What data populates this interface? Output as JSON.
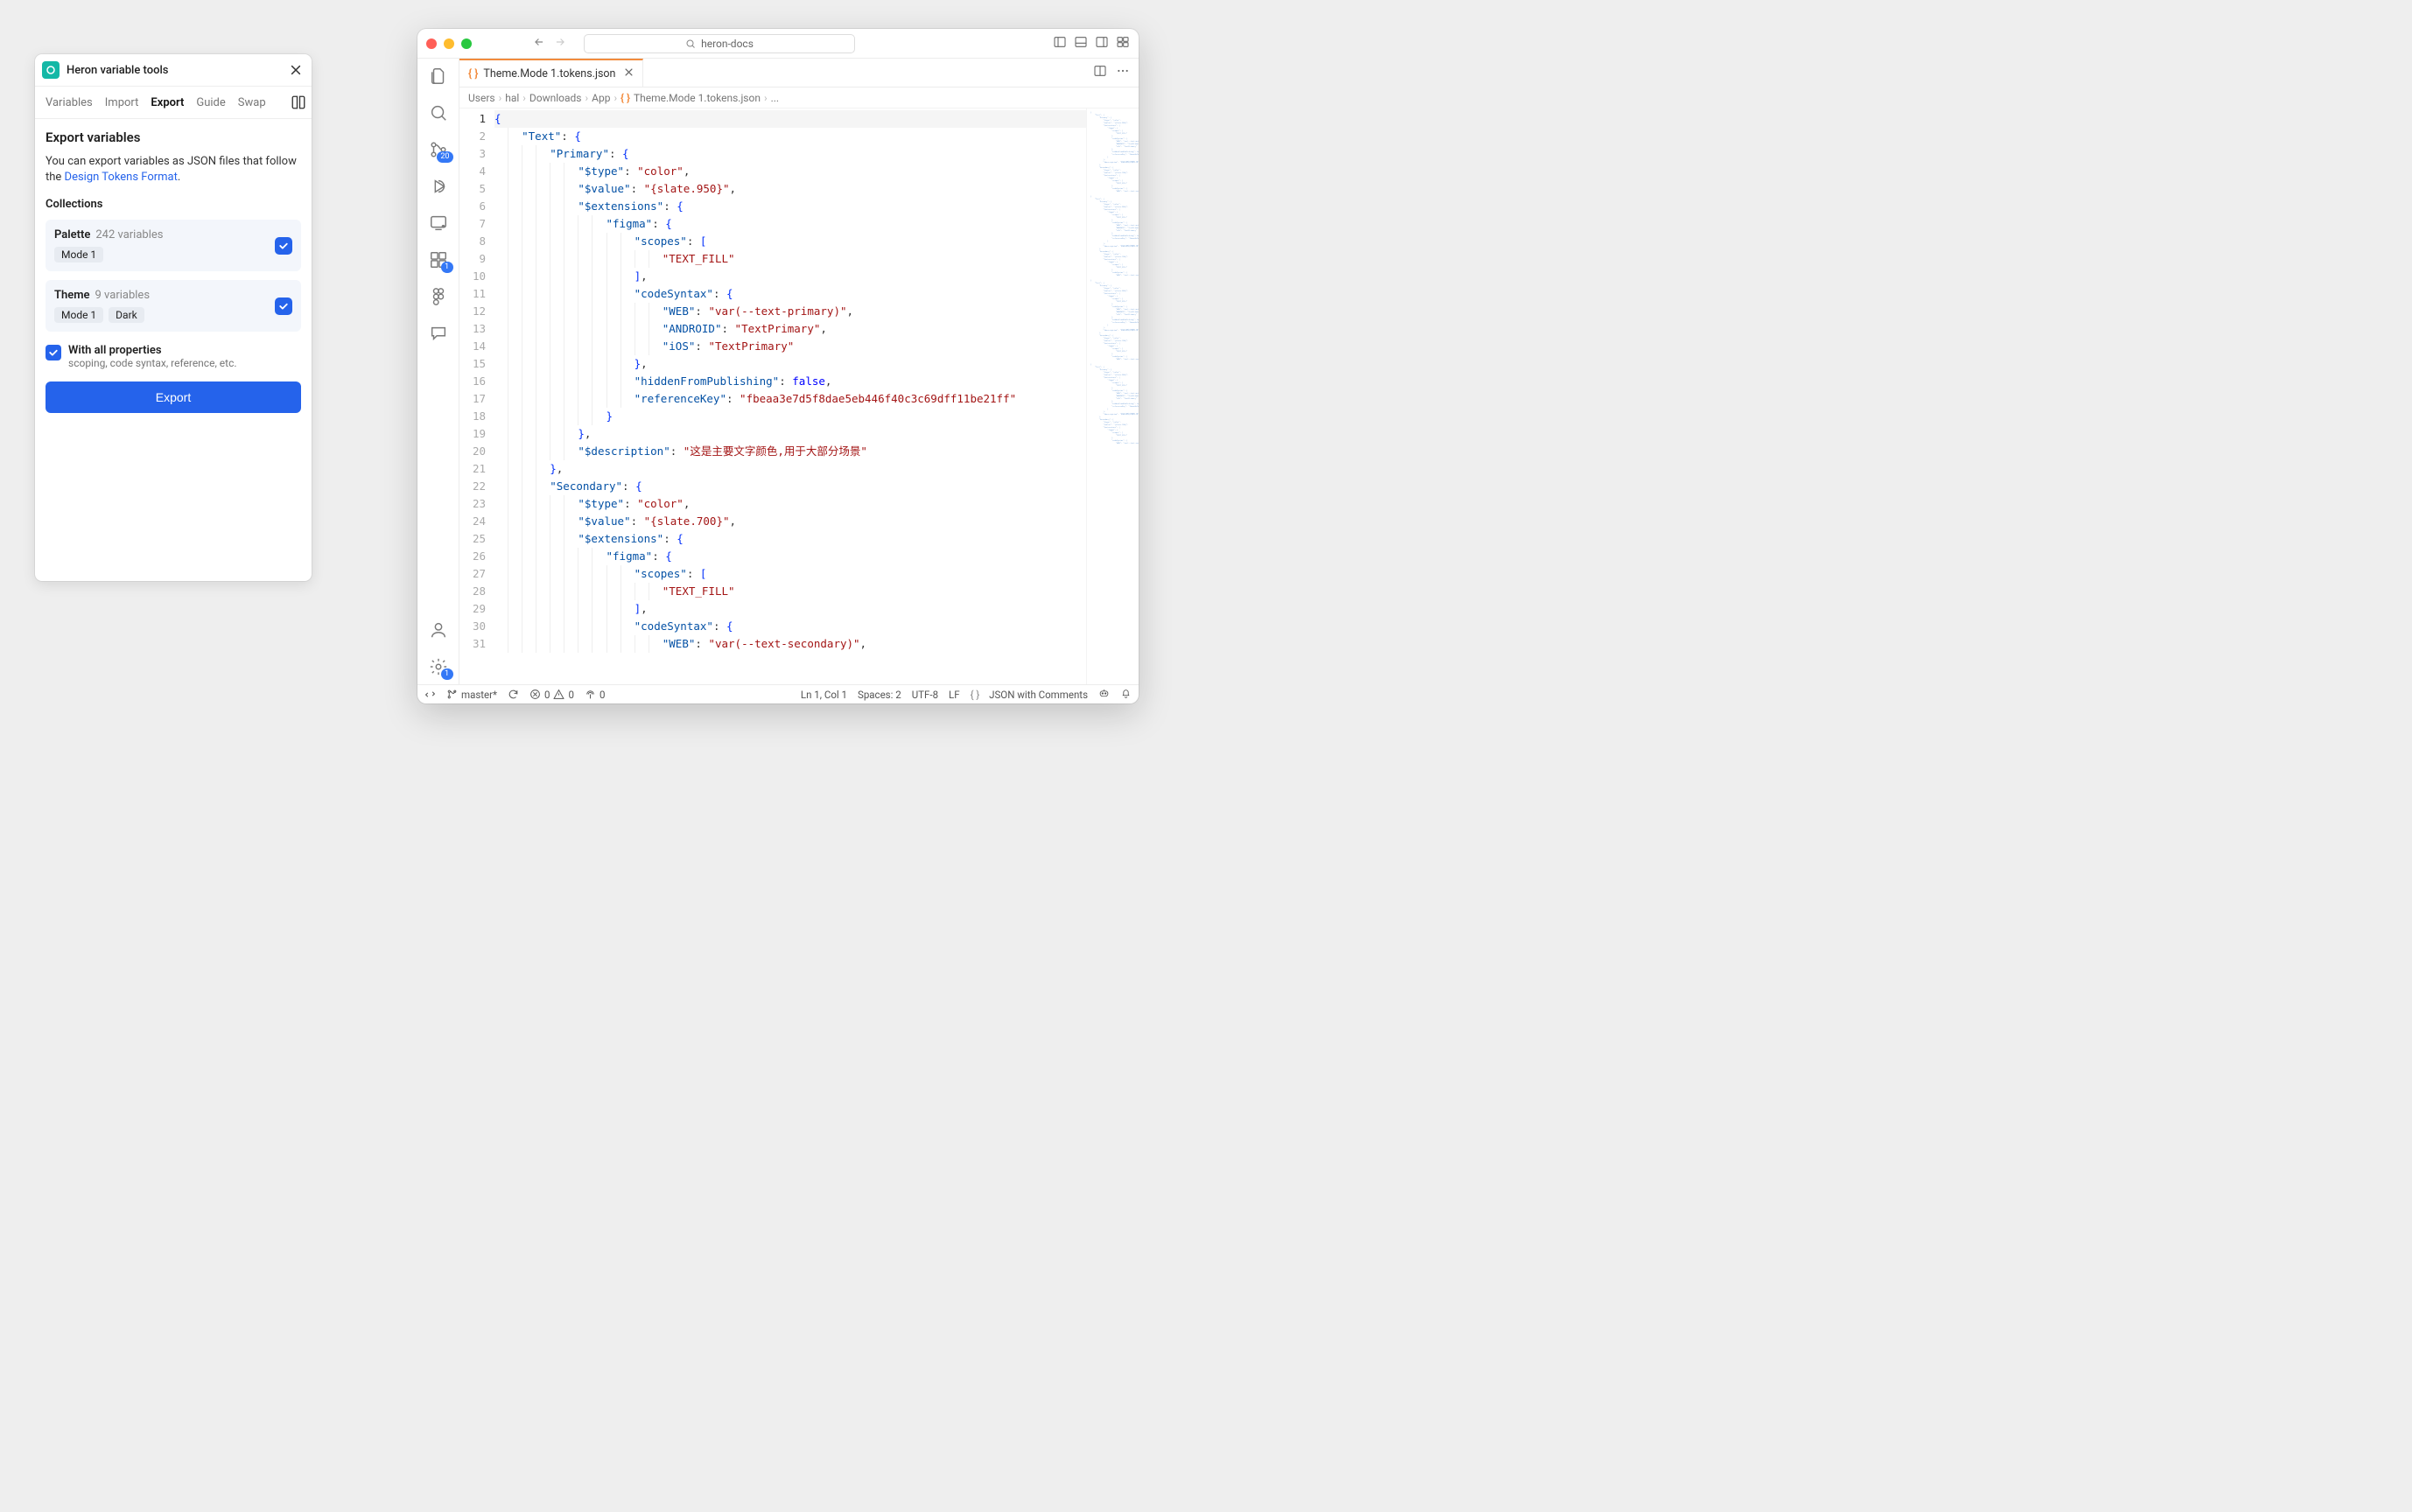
{
  "panel": {
    "title": "Heron variable tools",
    "tabs": {
      "variables": "Variables",
      "import": "Import",
      "export": "Export",
      "guide": "Guide",
      "swap": "Swap"
    },
    "heading": "Export variables",
    "desc_prefix": "You can export variables as JSON files that follow the ",
    "desc_link": "Design Tokens Format",
    "desc_suffix": ".",
    "collections_label": "Collections",
    "collections": [
      {
        "name": "Palette",
        "count": "242 variables",
        "modes": [
          "Mode 1"
        ]
      },
      {
        "name": "Theme",
        "count": "9 variables",
        "modes": [
          "Mode 1",
          "Dark"
        ]
      }
    ],
    "option": {
      "label": "With all properties",
      "sub": "scoping, code syntax, reference, etc."
    },
    "export_button": "Export"
  },
  "vscode": {
    "search_text": "heron-docs",
    "tab": {
      "name": "Theme.Mode 1.tokens.json"
    },
    "breadcrumb": [
      "Users",
      "hal",
      "Downloads",
      "App",
      "Theme.Mode 1.tokens.json",
      "..."
    ],
    "activity_badges": {
      "scm": "20",
      "ext": "1",
      "gear": "1"
    },
    "code_lines": [
      [
        {
          "t": "brace",
          "v": "{"
        }
      ],
      [
        {
          "pad": 2
        },
        {
          "t": "key",
          "v": "\"Text\""
        },
        {
          "t": "punc",
          "v": ": "
        },
        {
          "t": "brace",
          "v": "{"
        }
      ],
      [
        {
          "pad": 4
        },
        {
          "t": "key",
          "v": "\"Primary\""
        },
        {
          "t": "punc",
          "v": ": "
        },
        {
          "t": "brace",
          "v": "{"
        }
      ],
      [
        {
          "pad": 6
        },
        {
          "t": "key",
          "v": "\"$type\""
        },
        {
          "t": "punc",
          "v": ": "
        },
        {
          "t": "str",
          "v": "\"color\""
        },
        {
          "t": "punc",
          "v": ","
        }
      ],
      [
        {
          "pad": 6
        },
        {
          "t": "key",
          "v": "\"$value\""
        },
        {
          "t": "punc",
          "v": ": "
        },
        {
          "t": "str",
          "v": "\"{slate.950}\""
        },
        {
          "t": "punc",
          "v": ","
        }
      ],
      [
        {
          "pad": 6
        },
        {
          "t": "key",
          "v": "\"$extensions\""
        },
        {
          "t": "punc",
          "v": ": "
        },
        {
          "t": "brace",
          "v": "{"
        }
      ],
      [
        {
          "pad": 8
        },
        {
          "t": "key",
          "v": "\"figma\""
        },
        {
          "t": "punc",
          "v": ": "
        },
        {
          "t": "brace",
          "v": "{"
        }
      ],
      [
        {
          "pad": 10
        },
        {
          "t": "key",
          "v": "\"scopes\""
        },
        {
          "t": "punc",
          "v": ": "
        },
        {
          "t": "brace",
          "v": "["
        }
      ],
      [
        {
          "pad": 12
        },
        {
          "t": "str",
          "v": "\"TEXT_FILL\""
        }
      ],
      [
        {
          "pad": 10
        },
        {
          "t": "brace",
          "v": "]"
        },
        {
          "t": "punc",
          "v": ","
        }
      ],
      [
        {
          "pad": 10
        },
        {
          "t": "key",
          "v": "\"codeSyntax\""
        },
        {
          "t": "punc",
          "v": ": "
        },
        {
          "t": "brace",
          "v": "{"
        }
      ],
      [
        {
          "pad": 12
        },
        {
          "t": "key",
          "v": "\"WEB\""
        },
        {
          "t": "punc",
          "v": ": "
        },
        {
          "t": "str",
          "v": "\"var(--text-primary)\""
        },
        {
          "t": "punc",
          "v": ","
        }
      ],
      [
        {
          "pad": 12
        },
        {
          "t": "key",
          "v": "\"ANDROID\""
        },
        {
          "t": "punc",
          "v": ": "
        },
        {
          "t": "str",
          "v": "\"TextPrimary\""
        },
        {
          "t": "punc",
          "v": ","
        }
      ],
      [
        {
          "pad": 12
        },
        {
          "t": "key",
          "v": "\"iOS\""
        },
        {
          "t": "punc",
          "v": ": "
        },
        {
          "t": "str",
          "v": "\"TextPrimary\""
        }
      ],
      [
        {
          "pad": 10
        },
        {
          "t": "brace",
          "v": "}"
        },
        {
          "t": "punc",
          "v": ","
        }
      ],
      [
        {
          "pad": 10
        },
        {
          "t": "key",
          "v": "\"hiddenFromPublishing\""
        },
        {
          "t": "punc",
          "v": ": "
        },
        {
          "t": "bool",
          "v": "false"
        },
        {
          "t": "punc",
          "v": ","
        }
      ],
      [
        {
          "pad": 10
        },
        {
          "t": "key",
          "v": "\"referenceKey\""
        },
        {
          "t": "punc",
          "v": ": "
        },
        {
          "t": "str",
          "v": "\"fbeaa3e7d5f8dae5eb446f40c3c69dff11be21ff\""
        }
      ],
      [
        {
          "pad": 8
        },
        {
          "t": "brace",
          "v": "}"
        }
      ],
      [
        {
          "pad": 6
        },
        {
          "t": "brace",
          "v": "}"
        },
        {
          "t": "punc",
          "v": ","
        }
      ],
      [
        {
          "pad": 6
        },
        {
          "t": "key",
          "v": "\"$description\""
        },
        {
          "t": "punc",
          "v": ": "
        },
        {
          "t": "str",
          "v": "\"这是主要文字颜色,用于大部分场景\""
        }
      ],
      [
        {
          "pad": 4
        },
        {
          "t": "brace",
          "v": "}"
        },
        {
          "t": "punc",
          "v": ","
        }
      ],
      [
        {
          "pad": 4
        },
        {
          "t": "key",
          "v": "\"Secondary\""
        },
        {
          "t": "punc",
          "v": ": "
        },
        {
          "t": "brace",
          "v": "{"
        }
      ],
      [
        {
          "pad": 6
        },
        {
          "t": "key",
          "v": "\"$type\""
        },
        {
          "t": "punc",
          "v": ": "
        },
        {
          "t": "str",
          "v": "\"color\""
        },
        {
          "t": "punc",
          "v": ","
        }
      ],
      [
        {
          "pad": 6
        },
        {
          "t": "key",
          "v": "\"$value\""
        },
        {
          "t": "punc",
          "v": ": "
        },
        {
          "t": "str",
          "v": "\"{slate.700}\""
        },
        {
          "t": "punc",
          "v": ","
        }
      ],
      [
        {
          "pad": 6
        },
        {
          "t": "key",
          "v": "\"$extensions\""
        },
        {
          "t": "punc",
          "v": ": "
        },
        {
          "t": "brace",
          "v": "{"
        }
      ],
      [
        {
          "pad": 8
        },
        {
          "t": "key",
          "v": "\"figma\""
        },
        {
          "t": "punc",
          "v": ": "
        },
        {
          "t": "brace",
          "v": "{"
        }
      ],
      [
        {
          "pad": 10
        },
        {
          "t": "key",
          "v": "\"scopes\""
        },
        {
          "t": "punc",
          "v": ": "
        },
        {
          "t": "brace",
          "v": "["
        }
      ],
      [
        {
          "pad": 12
        },
        {
          "t": "str",
          "v": "\"TEXT_FILL\""
        }
      ],
      [
        {
          "pad": 10
        },
        {
          "t": "brace",
          "v": "]"
        },
        {
          "t": "punc",
          "v": ","
        }
      ],
      [
        {
          "pad": 10
        },
        {
          "t": "key",
          "v": "\"codeSyntax\""
        },
        {
          "t": "punc",
          "v": ": "
        },
        {
          "t": "brace",
          "v": "{"
        }
      ],
      [
        {
          "pad": 12
        },
        {
          "t": "key",
          "v": "\"WEB\""
        },
        {
          "t": "punc",
          "v": ": "
        },
        {
          "t": "str",
          "v": "\"var(--text-secondary)\""
        },
        {
          "t": "punc",
          "v": ","
        }
      ]
    ],
    "status": {
      "remote": "",
      "branch": "master*",
      "sync": "",
      "errors": "0",
      "warnings": "0",
      "ports": "0",
      "ln_col": "Ln 1, Col 1",
      "spaces": "Spaces: 2",
      "encoding": "UTF-8",
      "eol": "LF",
      "lang": "JSON with Comments"
    }
  }
}
